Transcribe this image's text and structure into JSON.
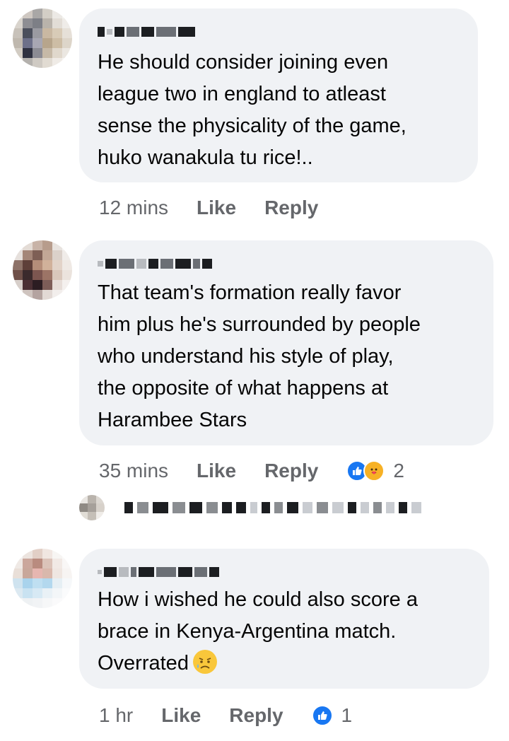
{
  "comments": [
    {
      "author": "",
      "text_lines": [
        "He should consider joining even",
        "league two in england to atleast",
        "sense the physicality of the game,",
        "huko wanakula tu rice!.."
      ],
      "time": "12 mins",
      "like_label": "Like",
      "reply_label": "Reply"
    },
    {
      "author": "",
      "text_lines": [
        "That team's formation really favor",
        "him plus he's surrounded by people",
        "who understand his style of play,",
        "the opposite of what happens at",
        "Harambee Stars"
      ],
      "time": "35 mins",
      "like_label": "Like",
      "reply_label": "Reply",
      "reaction_icons": [
        "like-icon",
        "care-icon"
      ],
      "reaction_count": "2"
    },
    {
      "author": "",
      "text_lines": [
        "How i wished he could also score a",
        "brace in Kenya-Argentina match.",
        "Overrated"
      ],
      "trailing_emoji": "sad-relieved-face-icon",
      "time": "1 hr",
      "like_label": "Like",
      "reply_label": "Reply",
      "reaction_icons": [
        "like-icon"
      ],
      "reaction_count": "1"
    }
  ],
  "colors": {
    "bubble": "#f0f2f5",
    "text": "#050505",
    "meta": "#65676b",
    "like_blue": "#1877f2"
  }
}
